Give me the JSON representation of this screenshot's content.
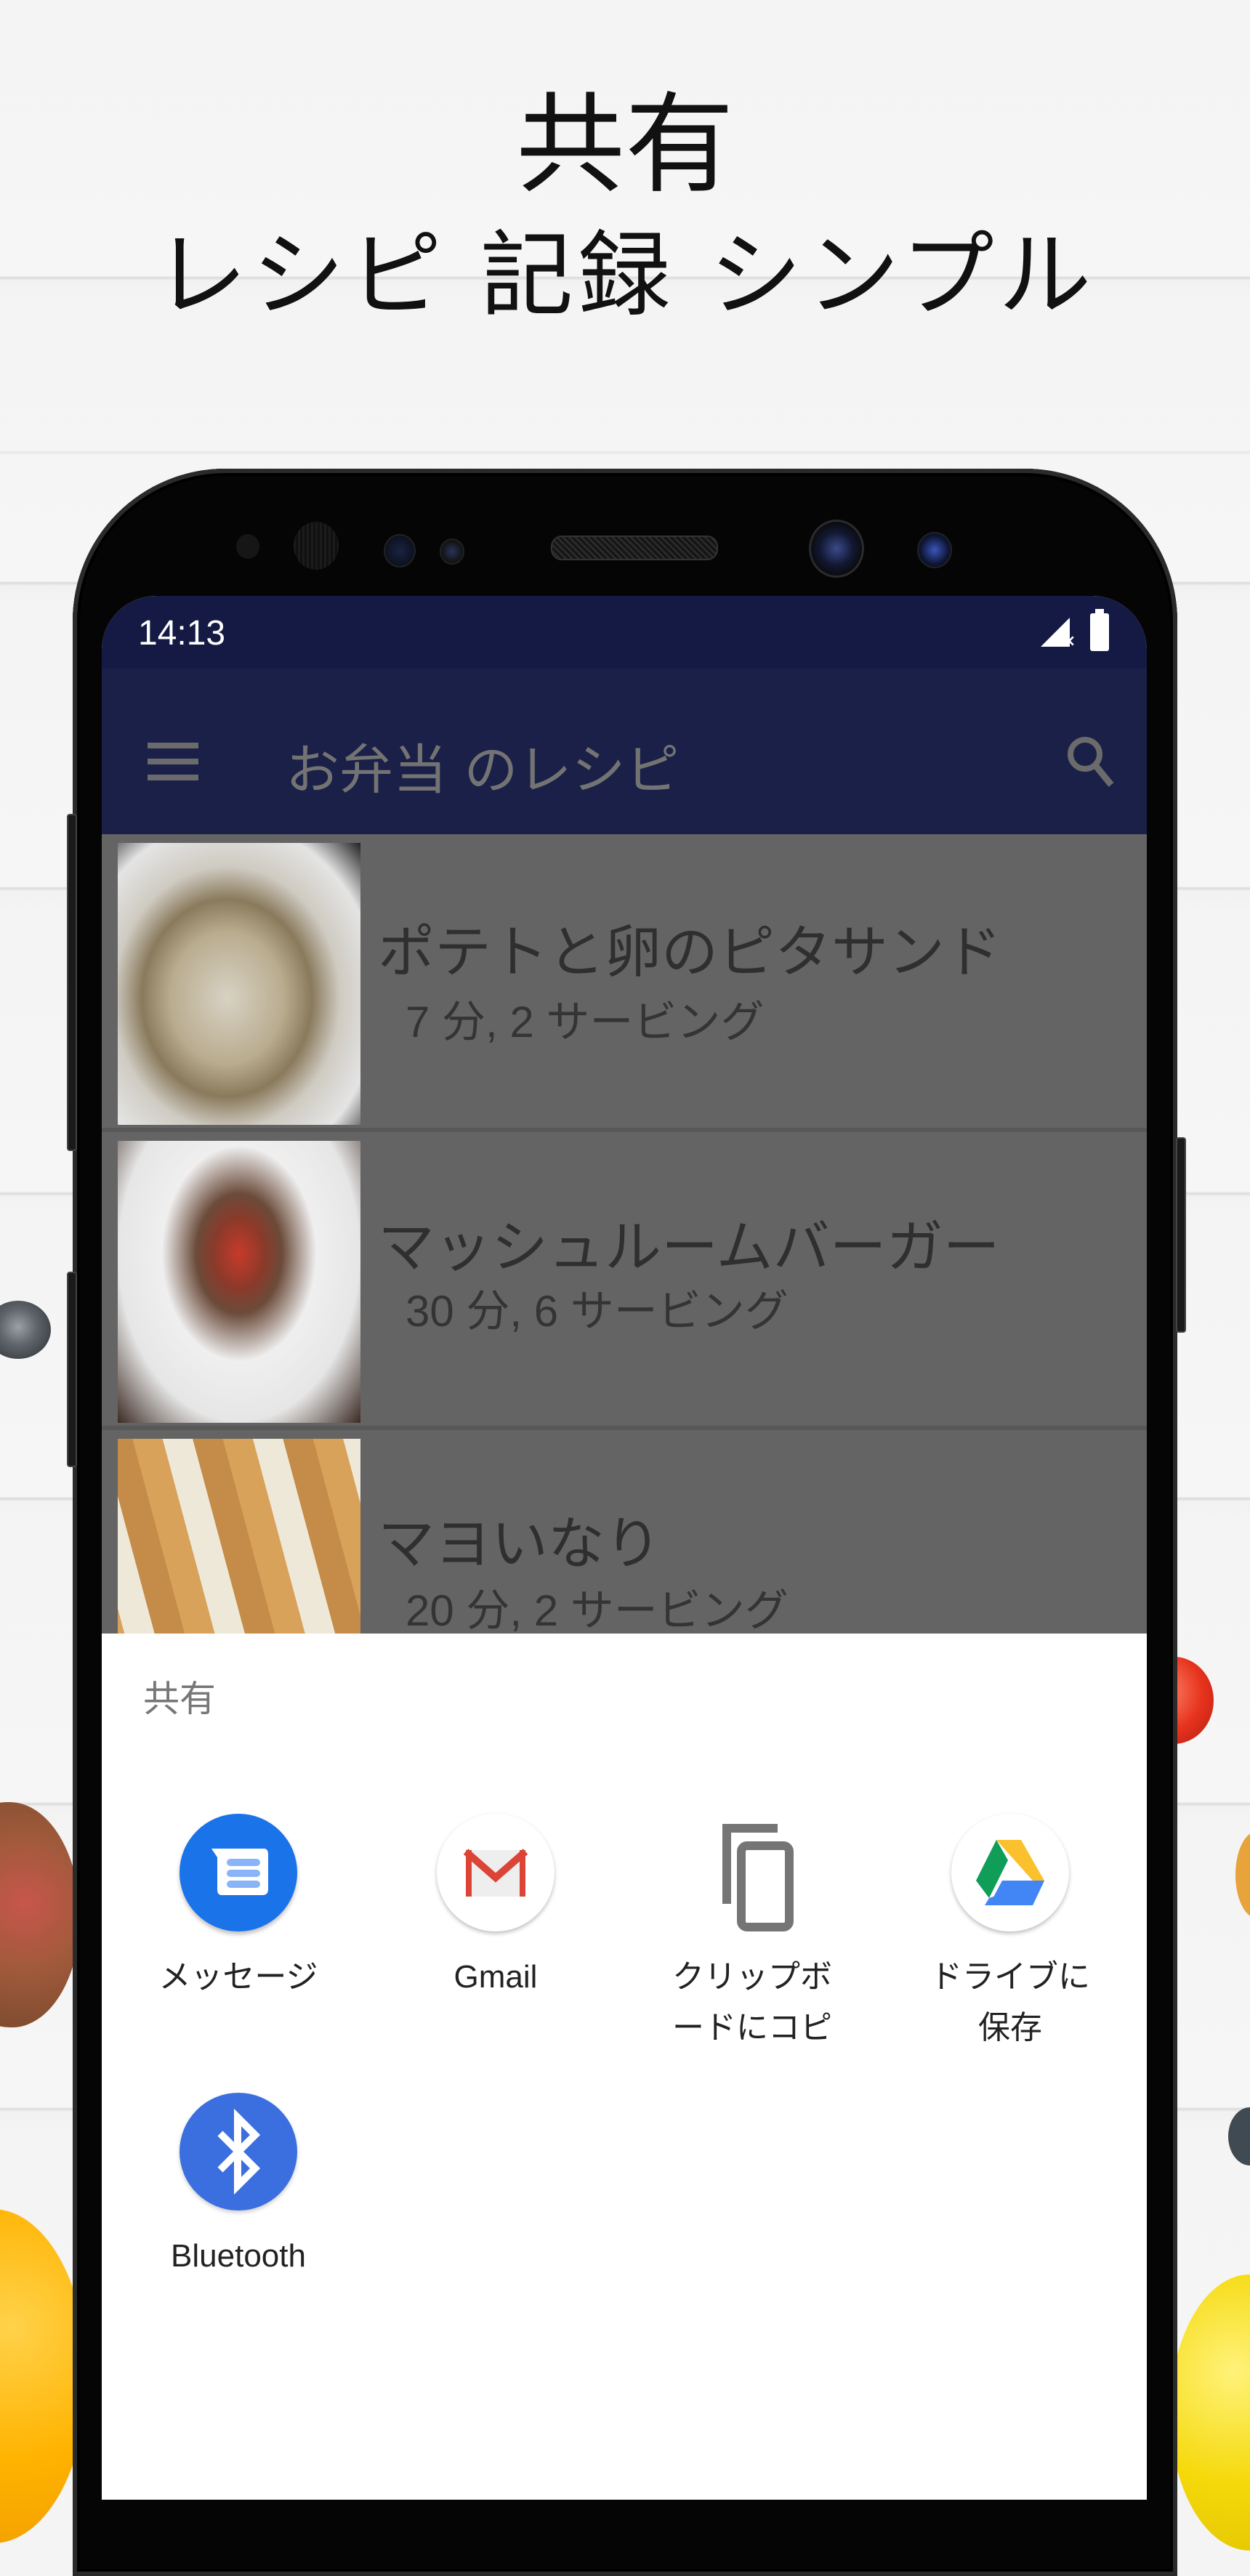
{
  "promo": {
    "title": "共有",
    "subtitle": "レシピ 記録 シンプル"
  },
  "status_bar": {
    "time": "14:13",
    "signal_icon": "signal-no-sim-icon",
    "battery_icon": "battery-full-icon"
  },
  "app_bar": {
    "menu_icon": "hamburger-menu-icon",
    "title": "お弁当 のレシピ",
    "search_icon": "search-icon"
  },
  "recipes": [
    {
      "title": "ポテトと卵のピタサンド",
      "meta": "7 分, 2 サービング",
      "image": "pita-sandwich-photo"
    },
    {
      "title": "マッシュルームバーガー",
      "meta": "30 分, 6 サービング",
      "image": "mushroom-burger-photo"
    },
    {
      "title": "マヨいなり",
      "meta": "20 分, 2 サービング",
      "image": "mayo-inari-photo"
    }
  ],
  "share_sheet": {
    "title": "共有",
    "targets": [
      {
        "label": "メッセージ",
        "icon": "messages-icon",
        "color": "#1a73e8"
      },
      {
        "label": "Gmail",
        "icon": "gmail-icon",
        "color": "#db4437"
      },
      {
        "label": "クリップボ\nードにコピ",
        "icon": "copy-clipboard-icon",
        "color": "#757575"
      },
      {
        "label": "ドライブに\n保存",
        "icon": "google-drive-icon",
        "color": "#0f9d58"
      },
      {
        "label": "Bluetooth",
        "icon": "bluetooth-icon",
        "color": "#3b6fe0"
      }
    ]
  },
  "colors": {
    "status_bar": "#141a44",
    "app_bar": "#1a2048",
    "scrim": "#646464"
  }
}
